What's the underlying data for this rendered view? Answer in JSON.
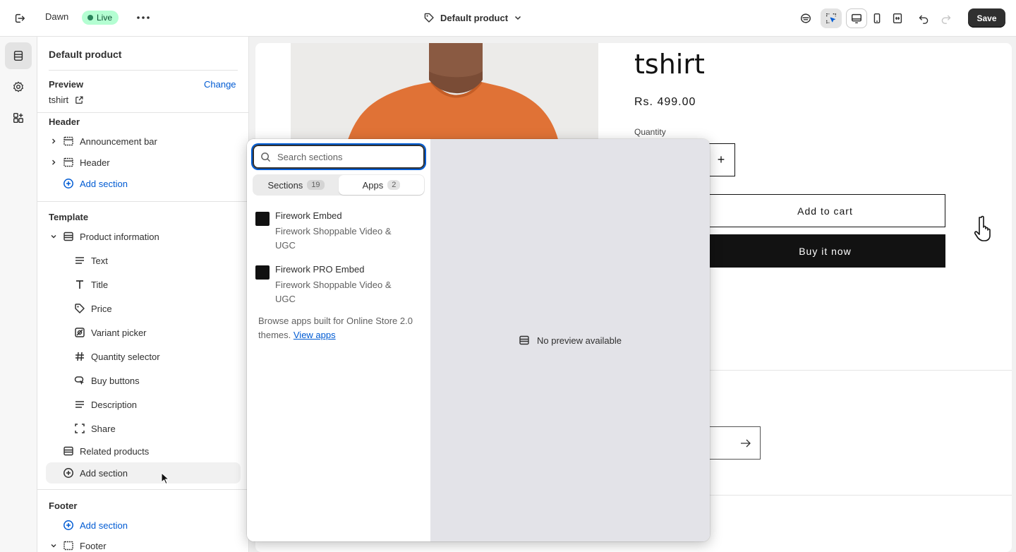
{
  "topbar": {
    "theme_name": "Dawn",
    "status_badge": "Live",
    "page_selector": "Default product",
    "save_label": "Save"
  },
  "sidebar": {
    "title": "Default product",
    "preview": {
      "label": "Preview",
      "change_label": "Change",
      "value": "tshirt"
    },
    "header_group": {
      "label": "Header",
      "items": [
        "Announcement bar",
        "Header"
      ],
      "add_label": "Add section"
    },
    "template_group": {
      "label": "Template",
      "section": "Product information",
      "blocks": [
        "Text",
        "Title",
        "Price",
        "Variant picker",
        "Quantity selector",
        "Buy buttons",
        "Description",
        "Share"
      ],
      "related": "Related products",
      "add_label": "Add section"
    },
    "footer_group": {
      "label": "Footer",
      "add_label": "Add section",
      "item": "Footer"
    }
  },
  "product": {
    "title": "tshirt",
    "price": "Rs. 499.00",
    "quantity_label": "Quantity",
    "quantity_plus": "+",
    "add_to_cart": "Add to cart",
    "buy_now": "Buy it now"
  },
  "picker": {
    "search_placeholder": "Search sections",
    "tabs": [
      {
        "label": "Sections",
        "count": "19"
      },
      {
        "label": "Apps",
        "count": "2"
      }
    ],
    "apps": [
      {
        "name": "Firework Embed",
        "subtitle": "Firework Shoppable Video & UGC"
      },
      {
        "name": "Firework PRO Embed",
        "subtitle": "Firework Shoppable Video & UGC"
      }
    ],
    "browse_text": "Browse apps built for Online Store 2.0 themes.",
    "browse_link": "View apps",
    "no_preview": "No preview available"
  },
  "colors": {
    "accent": "#005bd3",
    "live_badge_bg": "#b4fed2",
    "save_button": "#303030",
    "product_shirt": "#e07236"
  }
}
